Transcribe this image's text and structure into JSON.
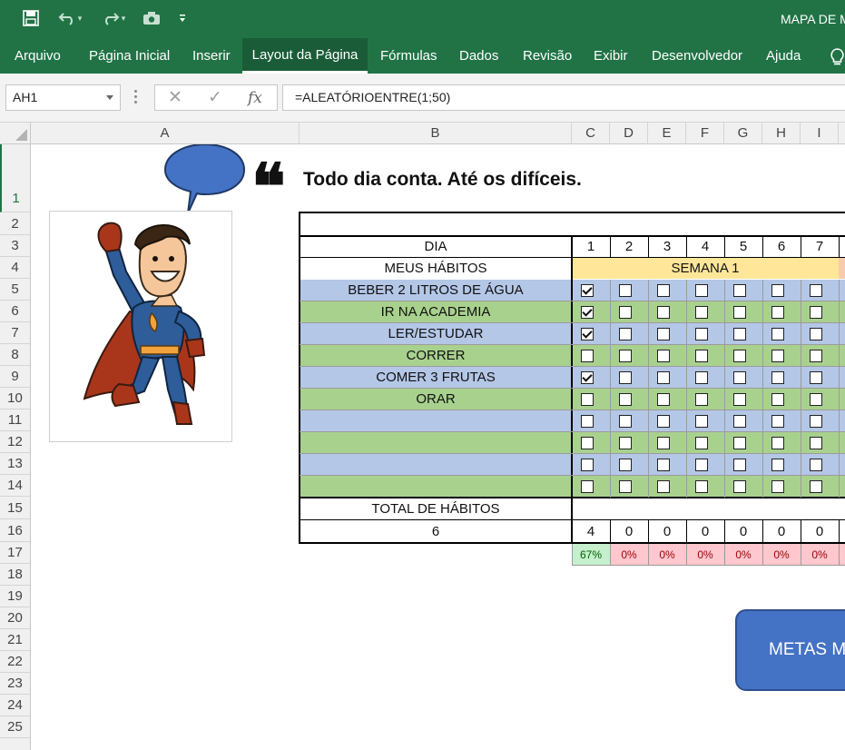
{
  "titlebar": {
    "document_title": "MAPA DE M",
    "quick_access": [
      "save-icon",
      "undo-icon",
      "redo-icon",
      "camera-icon",
      "customize-icon"
    ]
  },
  "ribbon": {
    "tabs": [
      {
        "label": "Arquivo",
        "active": false
      },
      {
        "label": "Página Inicial",
        "active": false
      },
      {
        "label": "Inserir",
        "active": false
      },
      {
        "label": "Layout da Página",
        "active": true
      },
      {
        "label": "Fórmulas",
        "active": false
      },
      {
        "label": "Dados",
        "active": false
      },
      {
        "label": "Revisão",
        "active": false
      },
      {
        "label": "Exibir",
        "active": false
      },
      {
        "label": "Desenvolvedor",
        "active": false
      },
      {
        "label": "Ajuda",
        "active": false
      }
    ]
  },
  "formula_bar": {
    "name_box": "AH1",
    "fx_label": "fx",
    "formula": "=ALEATÓRIOENTRE(1;50)"
  },
  "grid": {
    "columns": [
      "A",
      "B",
      "C",
      "D",
      "E",
      "F",
      "G",
      "H",
      "I"
    ],
    "rows": [
      "1",
      "2",
      "3",
      "4",
      "5",
      "6",
      "7",
      "8",
      "9",
      "10",
      "11",
      "12",
      "13",
      "14",
      "15",
      "16",
      "17",
      "18",
      "19",
      "20",
      "21",
      "22",
      "23",
      "24",
      "25"
    ]
  },
  "sheet": {
    "quote": "Todo dia conta. Até os difíceis.",
    "quote_mark": "❝",
    "dia_label": "DIA",
    "habits_label": "MEUS HÁBITOS",
    "week_label": "SEMANA 1",
    "days": [
      "1",
      "2",
      "3",
      "4",
      "5",
      "6",
      "7"
    ],
    "habits": [
      {
        "name": "BEBER 2 LITROS DE ÁGUA",
        "checks": [
          true,
          false,
          false,
          false,
          false,
          false,
          false
        ]
      },
      {
        "name": "IR NA ACADEMIA",
        "checks": [
          true,
          false,
          false,
          false,
          false,
          false,
          false
        ]
      },
      {
        "name": "LER/ESTUDAR",
        "checks": [
          true,
          false,
          false,
          false,
          false,
          false,
          false
        ]
      },
      {
        "name": "CORRER",
        "checks": [
          false,
          false,
          false,
          false,
          false,
          false,
          false
        ]
      },
      {
        "name": "COMER 3 FRUTAS",
        "checks": [
          true,
          false,
          false,
          false,
          false,
          false,
          false
        ]
      },
      {
        "name": "ORAR",
        "checks": [
          false,
          false,
          false,
          false,
          false,
          false,
          false
        ]
      },
      {
        "name": "",
        "checks": [
          false,
          false,
          false,
          false,
          false,
          false,
          false
        ]
      },
      {
        "name": "",
        "checks": [
          false,
          false,
          false,
          false,
          false,
          false,
          false
        ]
      },
      {
        "name": "",
        "checks": [
          false,
          false,
          false,
          false,
          false,
          false,
          false
        ]
      },
      {
        "name": "",
        "checks": [
          false,
          false,
          false,
          false,
          false,
          false,
          false
        ]
      }
    ],
    "total_label": "TOTAL DE HÁBITOS",
    "total_value": "6",
    "day_totals": [
      "4",
      "0",
      "0",
      "0",
      "0",
      "0",
      "0"
    ],
    "day_percents": [
      "67%",
      "0%",
      "0%",
      "0%",
      "0%",
      "0%",
      "0%"
    ],
    "metas_button": "METAS M"
  },
  "colors": {
    "excel_green": "#217346",
    "row_blue": "#b4c7e7",
    "row_green": "#a9d18e",
    "week_yellow": "#ffe699",
    "pct_good_bg": "#c6efce",
    "pct_good_fg": "#006100",
    "pct_bad_bg": "#ffc7ce",
    "pct_bad_fg": "#9c0006",
    "button_blue": "#4472c4"
  }
}
